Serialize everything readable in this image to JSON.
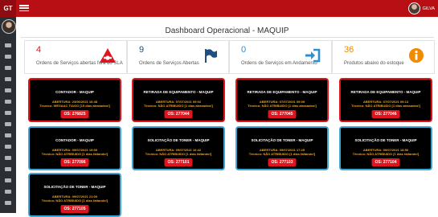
{
  "header": {
    "logo": "GT",
    "user_name": "GILVA",
    "bar_color": "#b80f14"
  },
  "page": {
    "title": "Dashboard Operacional - MAQUIP"
  },
  "stats": [
    {
      "value": "4",
      "label": "Ordens de Serviços abertas fora do SLA",
      "color": "#e0141c",
      "icon": "warning-triangle-icon"
    },
    {
      "value": "9",
      "label": "Ordens de Serviços Abertas",
      "color": "#1f4f80",
      "icon": "flag-icon"
    },
    {
      "value": "0",
      "label": "Ordens de Serviços em Andamento",
      "color": "#2b8fd1",
      "icon": "login-arrow-icon"
    },
    {
      "value": "36",
      "label": "Produtos abaixo do estoque",
      "color": "#f08a00",
      "icon": "info-circle-icon"
    }
  ],
  "tickets": [
    {
      "title": "CONTADOR - MAQUIP",
      "opened": "ABERTURA: 23/06/2021 16:48",
      "tech": "Técnico: WESAAC TIAGO [15 dias atrasados!]",
      "os": "OS: 276825",
      "border": "red"
    },
    {
      "title": "RETIRADA DE EQUIPAMENTO - MAQUIP",
      "opened": "ABERTURA: 07/07/2021 09:02",
      "tech": "Técnico: NÃO ATRIBUIDO [1 dias atrasados!]",
      "os": "OS: 277044",
      "border": "red"
    },
    {
      "title": "RETIRADA DE EQUIPAMENTO - MAQUIP",
      "opened": "ABERTURA: 07/07/2021 09:09",
      "tech": "Técnico: NÃO ATRIBUIDO [1 dias atrasados!]",
      "os": "OS: 277045",
      "border": "red"
    },
    {
      "title": "RETIRADA DE EQUIPAMENTO - MAQUIP",
      "opened": "ABERTURA: 07/07/2021 09:13",
      "tech": "Técnico: NÃO ATRIBUIDO [1 dias atrasados!]",
      "os": "OS: 277046",
      "border": "red"
    },
    {
      "title": "CONTADOR - MAQUIP",
      "opened": "ABERTURA: 09/07/2021 15:00",
      "tech": "Técnico: NÃO ATRIBUIDO [1 dias faltando!]",
      "os": "OS: 277096",
      "border": "blue"
    },
    {
      "title": "SOLICITAÇÃO DE TONER - MAQUIP",
      "opened": "ABERTURA: 09/07/2021 16:42",
      "tech": "Técnico: NÃO ATRIBUIDO [1 dias faltando!]",
      "os": "OS: 277101",
      "border": "blue"
    },
    {
      "title": "SOLICITAÇÃO DE TONER - MAQUIP",
      "opened": "ABERTURA: 09/07/2021 17:25",
      "tech": "Técnico: NÃO ATRIBUIDO [1 dias faltando!]",
      "os": "OS: 277103",
      "border": "blue"
    },
    {
      "title": "SOLICITAÇÃO DE TONER - MAQUIP",
      "opened": "ABERTURA: 09/07/2021 18:50",
      "tech": "Técnico: NÃO ATRIBUIDO [1 dias faltando!]",
      "os": "OS: 277104",
      "border": "blue"
    },
    {
      "title": "SOLICITAÇÃO DE TONER - MAQUIP",
      "opened": "ABERTURA: 09/07/2021 21:00",
      "tech": "Técnico: NÃO ATRIBUIDO [1 dias faltando!]",
      "os": "OS: 277105",
      "border": "blue"
    }
  ]
}
